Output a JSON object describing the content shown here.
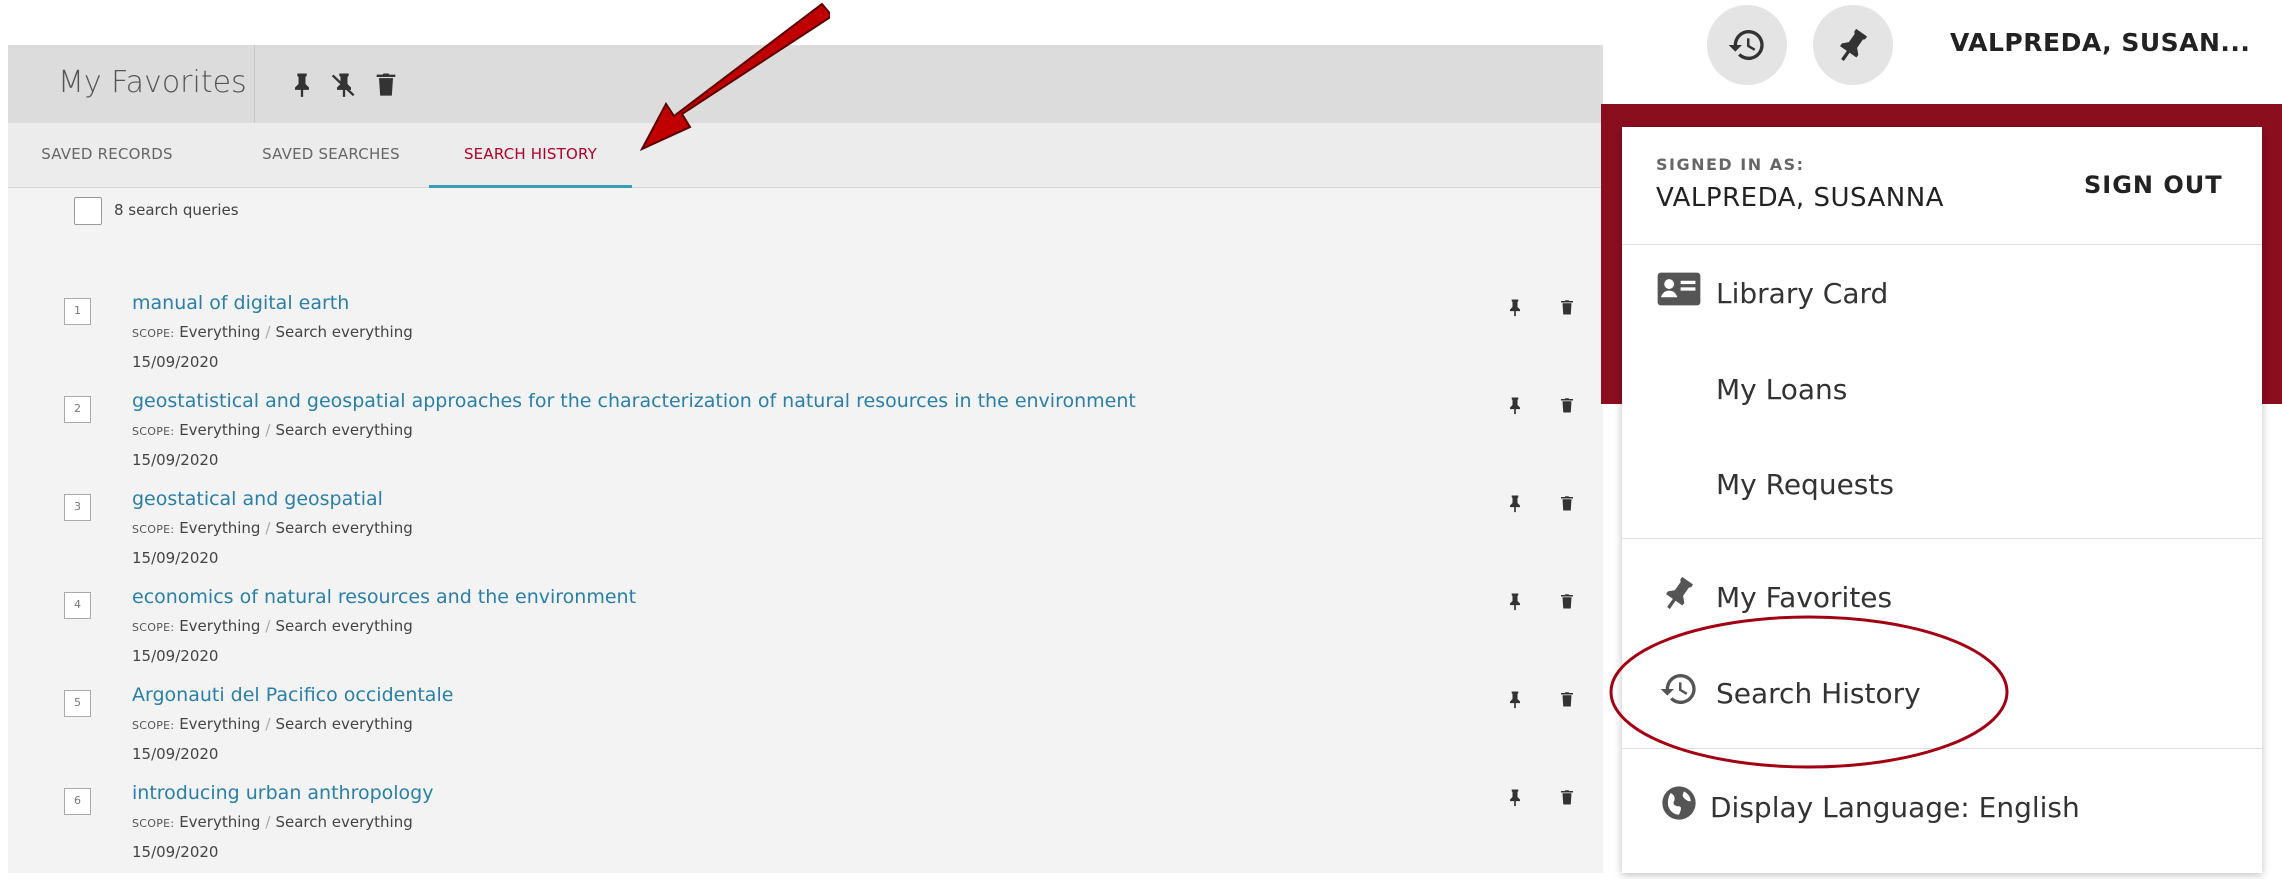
{
  "favorites": {
    "title": "My Favorites",
    "tabs": [
      "SAVED RECORDS",
      "SAVED SEARCHES",
      "SEARCH HISTORY"
    ],
    "active_tab": "SEARCH HISTORY",
    "count_label": "8 search queries",
    "scope_caption": "SCOPE:",
    "queries": [
      {
        "num": "1",
        "title": "manual of digital earth",
        "scope": "Everything",
        "collection": "Search everything",
        "date": "15/09/2020"
      },
      {
        "num": "2",
        "title": "geostatistical and geospatial approaches for the characterization of natural resources in the environment",
        "scope": "Everything",
        "collection": "Search everything",
        "date": "15/09/2020"
      },
      {
        "num": "3",
        "title": "geostatical and geospatial",
        "scope": "Everything",
        "collection": "Search everything",
        "date": "15/09/2020"
      },
      {
        "num": "4",
        "title": "economics of natural resources and the environment",
        "scope": "Everything",
        "collection": "Search everything",
        "date": "15/09/2020"
      },
      {
        "num": "5",
        "title": "Argonauti del Pacifico occidentale",
        "scope": "Everything",
        "collection": "Search everything",
        "date": "15/09/2020"
      },
      {
        "num": "6",
        "title": "introducing urban anthropology",
        "scope": "Everything",
        "collection": "Search everything",
        "date": "15/09/2020"
      }
    ]
  },
  "header": {
    "user_name": "VALPREDA, SUSAN..."
  },
  "user_menu": {
    "signed_in_caption": "SIGNED IN AS:",
    "signed_in_name": "VALPREDA, SUSANNA",
    "sign_out": "SIGN OUT",
    "items": [
      {
        "label": "Library Card",
        "icon": "id-card-icon"
      },
      {
        "label": "My Loans",
        "icon": ""
      },
      {
        "label": "My Requests",
        "icon": ""
      },
      {
        "label": "My Favorites",
        "icon": "pin-icon"
      },
      {
        "label": "Search History",
        "icon": "history-icon"
      },
      {
        "label": "Display Language: English",
        "icon": "globe-icon"
      }
    ]
  },
  "colors": {
    "active_tab": "#b0002a",
    "tab_underline": "#3b9db5",
    "link": "#2a7fa8",
    "red_band": "#8b0e1f",
    "annotation_red": "#c00000"
  }
}
